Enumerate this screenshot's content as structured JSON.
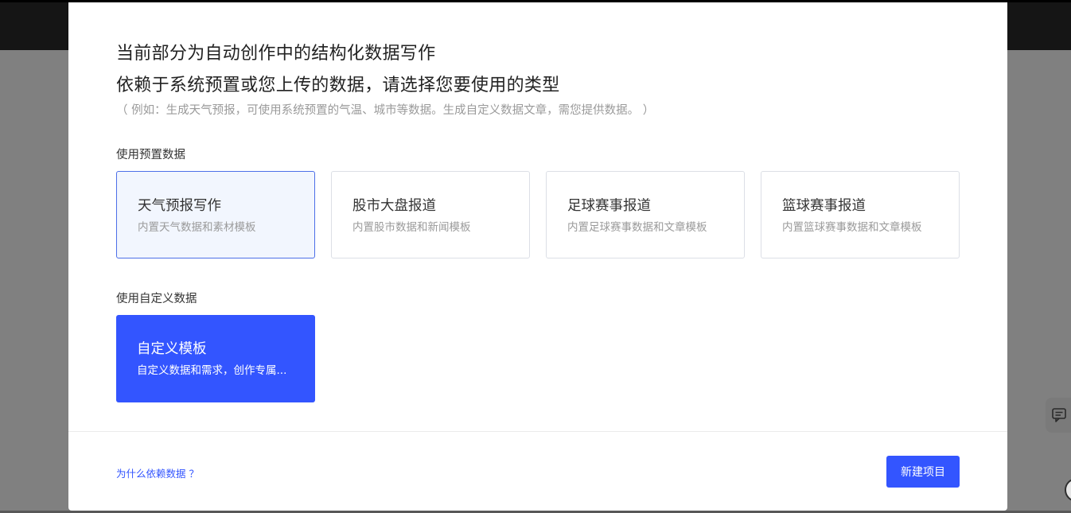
{
  "modal": {
    "title_line1": "当前部分为自动创作中的结构化数据写作",
    "title_line2": "依赖于系统预置或您上传的数据，请选择您要使用的类型",
    "hint": "（ 例如：生成天气预报，可使用系统预置的气温、城市等数据。生成自定义数据文章，需您提供数据。 ）",
    "preset_label": "使用预置数据",
    "preset_cards": [
      {
        "title": "天气预报写作",
        "desc": "内置天气数据和素材模板",
        "selected": true
      },
      {
        "title": "股市大盘报道",
        "desc": "内置股市数据和新闻模板",
        "selected": false
      },
      {
        "title": "足球赛事报道",
        "desc": "内置足球赛事数据和文章模板",
        "selected": false
      },
      {
        "title": "篮球赛事报道",
        "desc": "内置篮球赛事数据和文章模板",
        "selected": false
      }
    ],
    "custom_label": "使用自定义数据",
    "custom_card": {
      "title": "自定义模板",
      "desc": "自定义数据和需求，创作专属..."
    },
    "footer": {
      "why_link": "为什么依赖数据 ？",
      "new_project_button": "新建项目"
    }
  },
  "side_tools": {
    "feedback_icon": "chat-feedback-icon"
  },
  "colors": {
    "accent": "#3355ff",
    "selected_border": "#4d6fe8",
    "selected_background": "#f2f6fe"
  }
}
